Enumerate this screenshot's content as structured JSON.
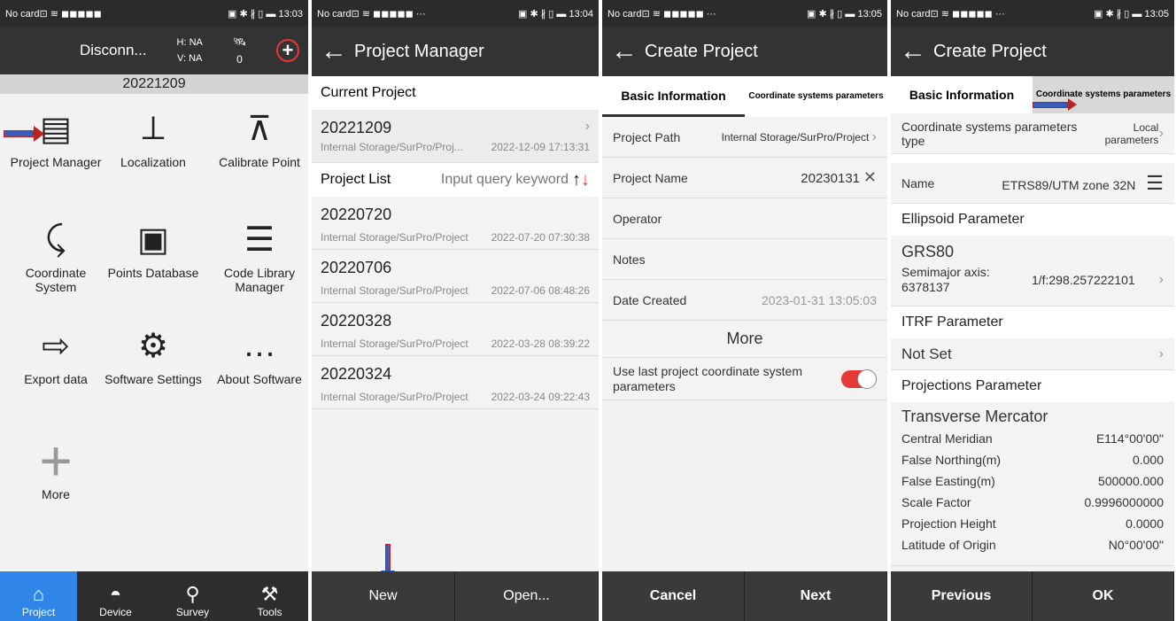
{
  "p1": {
    "status": {
      "left": "No card⊡ ≋ ◼◼◼◼◼",
      "right": "▣ ✱ ∦ ▯ ▬ 13:03"
    },
    "header": {
      "conn": "Disconn...",
      "h": "H: NA",
      "v": "V: NA",
      "sat": "0"
    },
    "project": "20221209",
    "grid": [
      {
        "icon": "project-manager-icon",
        "glyph": "▤",
        "label": "Project Manager"
      },
      {
        "icon": "localization-icon",
        "glyph": "⟂",
        "label": "Localization"
      },
      {
        "icon": "calibrate-point-icon",
        "glyph": "⊼",
        "label": "Calibrate Point"
      },
      {
        "icon": "coordinate-system-icon",
        "glyph": "⤹",
        "label": "Coordinate System"
      },
      {
        "icon": "points-database-icon",
        "glyph": "▣",
        "label": "Points Database"
      },
      {
        "icon": "code-library-icon",
        "glyph": "☰",
        "label": "Code Library Manager"
      },
      {
        "icon": "export-data-icon",
        "glyph": "⇨",
        "label": "Export data"
      },
      {
        "icon": "software-settings-icon",
        "glyph": "⚙",
        "label": "Software Settings"
      },
      {
        "icon": "about-software-icon",
        "glyph": "…",
        "label": "About Software"
      },
      {
        "icon": "more-icon",
        "glyph": "+",
        "label": "More"
      }
    ],
    "nav": [
      {
        "icon": "project-icon",
        "glyph": "⌂",
        "label": "Project"
      },
      {
        "icon": "device-icon",
        "glyph": "◓",
        "label": "Device"
      },
      {
        "icon": "survey-icon",
        "glyph": "⚲",
        "label": "Survey"
      },
      {
        "icon": "tools-icon",
        "glyph": "⚒",
        "label": "Tools"
      }
    ]
  },
  "p2": {
    "status": {
      "left": "No card⊡ ≋ ◼◼◼◼◼ ···",
      "right": "▣ ✱ ∦ ▯ ▬ 13:04"
    },
    "title": "Project Manager",
    "current_label": "Current Project",
    "current": {
      "name": "20221209",
      "path": "Internal Storage/SurPro/Proj...",
      "date": "2022-12-09 17:13:31"
    },
    "list_label": "Project List",
    "search_placeholder": "Input query keyword",
    "projects": [
      {
        "name": "20220720",
        "path": "Internal Storage/SurPro/Project",
        "date": "2022-07-20 07:30:38"
      },
      {
        "name": "20220706",
        "path": "Internal Storage/SurPro/Project",
        "date": "2022-07-06 08:48:26"
      },
      {
        "name": "20220328",
        "path": "Internal Storage/SurPro/Project",
        "date": "2022-03-28 08:39:22"
      },
      {
        "name": "20220324",
        "path": "Internal Storage/SurPro/Project",
        "date": "2022-03-24 09:22:43"
      }
    ],
    "new": "New",
    "open": "Open..."
  },
  "p3": {
    "status": {
      "left": "No card⊡ ≋ ◼◼◼◼◼ ···",
      "right": "▣ ✱ ∦ ▯ ▬ 13:05"
    },
    "title": "Create Project",
    "tab1": "Basic Information",
    "tab2": "Coordinate systems parameters",
    "path_label": "Project Path",
    "path_value": "Internal Storage/SurPro/Project",
    "name_label": "Project Name",
    "name_value": "20230131",
    "operator_label": "Operator",
    "notes_label": "Notes",
    "date_label": "Date Created",
    "date_value": "2023-01-31 13:05:03",
    "more": "More",
    "use_last": "Use last project coordinate system parameters",
    "cancel": "Cancel",
    "next": "Next"
  },
  "p4": {
    "status": {
      "left": "No card⊡ ≋ ◼◼◼◼◼ ···",
      "right": "▣ ✱ ∦ ▯ ▬ 13:05"
    },
    "title": "Create Project",
    "tab1": "Basic Information",
    "tab2": "Coordinate systems parameters",
    "cs_type_label": "Coordinate systems parameters type",
    "cs_type_value": "Local parameters",
    "name_label": "Name",
    "name_value": "ETRS89/UTM zone 32N",
    "ellipsoid_header": "Ellipsoid Parameter",
    "ellipsoid_name": "GRS80",
    "semimajor": "Semimajor axis: 6378137",
    "flattening": "1/f:298.257222101",
    "itrf_header": "ITRF Parameter",
    "itrf_value": "Not Set",
    "proj_header": "Projections Parameter",
    "proj_name": "Transverse Mercator",
    "params": [
      {
        "k": "Central Meridian",
        "v": "E114°00'00\""
      },
      {
        "k": "False Northing(m)",
        "v": "0.000"
      },
      {
        "k": "False Easting(m)",
        "v": "500000.000"
      },
      {
        "k": "Scale Factor",
        "v": "0.9996000000"
      },
      {
        "k": "Projection Height",
        "v": "0.0000"
      },
      {
        "k": "Latitude of Origin",
        "v": "N0°00'00\""
      }
    ],
    "prev": "Previous",
    "ok": "OK"
  }
}
